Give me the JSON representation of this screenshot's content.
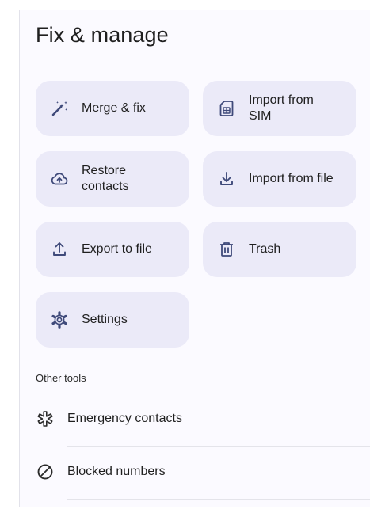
{
  "page": {
    "title": "Fix & manage"
  },
  "actions": [
    {
      "label": "Merge & fix",
      "icon": "magic-wand-icon"
    },
    {
      "label": "Import from\nSIM",
      "icon": "sim-card-icon"
    },
    {
      "label": "Restore\ncontacts",
      "icon": "cloud-restore-icon"
    },
    {
      "label": "Import from file",
      "icon": "download-icon"
    },
    {
      "label": "Export to file",
      "icon": "upload-icon"
    },
    {
      "label": "Trash",
      "icon": "trash-icon"
    },
    {
      "label": "Settings",
      "icon": "gear-icon"
    }
  ],
  "other_tools": {
    "heading": "Other tools",
    "items": [
      {
        "label": "Emergency contacts",
        "icon": "emergency-icon"
      },
      {
        "label": "Blocked numbers",
        "icon": "block-icon"
      }
    ]
  },
  "colors": {
    "card_bg": "#ebeaf8",
    "icon": "#3f4a7a",
    "text": "#1f1f1f"
  }
}
